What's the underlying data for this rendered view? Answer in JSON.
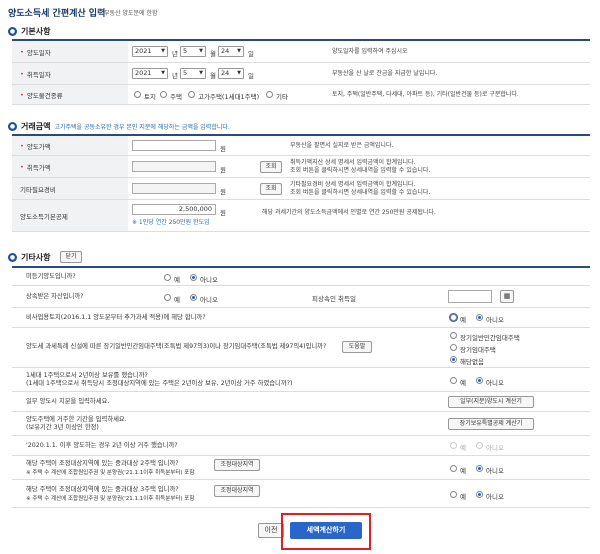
{
  "page": {
    "title": "양도소득세 간편계산 입력",
    "subtitle": "부동산 양도분에 한함"
  },
  "basic": {
    "heading": "기본사항",
    "transfer_date": {
      "label": "양도일자",
      "year": "2021",
      "year_unit": "년",
      "month": "5",
      "month_unit": "월",
      "day": "24",
      "day_unit": "일",
      "desc": "양도일자를 입력하여 주십시오"
    },
    "acquire_date": {
      "label": "취득일자",
      "year": "2021",
      "year_unit": "년",
      "month": "5",
      "month_unit": "월",
      "day": "24",
      "day_unit": "일",
      "desc": "부동산을 산 날로 잔금을 지급한 날입니다."
    },
    "property_type": {
      "label": "양도물건종류",
      "options": [
        "토지",
        "주택",
        "고가주택(1세대1주택)",
        "기타"
      ],
      "desc": "토지, 주택(일반주택, 다세대, 아파트 등), 기타(일반건물 등)로 구분합니다."
    }
  },
  "amount": {
    "heading": "거래금액",
    "note": "고가주택을 공동소유한 경우 본인 지분에 해당하는 금액을 입력합니다.",
    "transfer_price": {
      "label": "양도가액",
      "unit": "원",
      "desc": "부동산을 팔면서 실지로 받은 금액입니다."
    },
    "acquire_price": {
      "label": "취득가액",
      "unit": "원",
      "button": "조회",
      "desc": "취득가액지산 상세 명세서 입력금액이 합계입니다.\n조회 버튼을 클릭하시면 상세내역을 입력할 수 있습니다."
    },
    "other_cost": {
      "label": "기타필요경비",
      "unit": "원",
      "button": "조회",
      "desc": "기타필요경비 상세 명세서 입력금액이 합계입니다.\n조회 버튼을 클릭하시면 상세내역을 입력할 수 있습니다."
    },
    "basic_deduction": {
      "label": "양도소득기본공제",
      "value": "2,500,000",
      "unit": "원",
      "hint": "※ 1인당 연간 250만원 한도임",
      "desc": "해당 과세기간의 양도소득금액에서 인별로 연간 250만원 공제됩니다."
    }
  },
  "etc": {
    "heading": "기타사항",
    "close_button": "닫기",
    "q1": {
      "text": "미등기양도입니까?",
      "yes": "예",
      "no": "아니오"
    },
    "q2": {
      "text": "상속받은 자산입니까?",
      "yes": "예",
      "no": "아니오",
      "sub_label": "피상속인 취득일"
    },
    "q3": {
      "text": "비사업용토지(2016.1.1 양도분부터 추가과세 적용)에 해당 합니까?",
      "yes": "예",
      "no": "아니오"
    },
    "q4": {
      "text": "양도세 과세특례 신설에 따른 장기일반민간임대주택(조특법 제97의3)이나 장기임대주택(조특법 제97의4)입니까?",
      "help": "도움말",
      "options": [
        "장기일반민간임대주택",
        "장기임대주택",
        "해당없음"
      ]
    },
    "q5": {
      "text": "1세대 1주택으로서 2년이상 보유를 했습니까?",
      "text2": "(1세대 1주택으로서 취득당시 조정대상지역에 있는 주택은 2년이상 보유, 2년이상 거주 하였습니까?)",
      "yes": "예",
      "no": "아니오"
    },
    "q6": {
      "text": "일부 양도시 지분을 입력하세요.",
      "button": "일부(지분)양도시 계산기"
    },
    "q7": {
      "text": "양도주택에 거주한 기간을 입력하세요.",
      "text2": "(보유기간 3년 이상인 한정)",
      "button": "장기보유특별공제 계산기"
    },
    "q8": {
      "text": "'2020.1.1. 이후 양도하는 경우 2년 이상 거주 했습니까?",
      "yes": "예",
      "no": "아니오"
    },
    "q9": {
      "text": "해당 주택이 조정대상지역에 있는 중과대상 2주택 입니까?",
      "note": "※ 주택 수 계산에 조합원입주권 및 분양권('21.1.1이후 취득분부터) 포함",
      "button": "조정대상지역",
      "yes": "예",
      "no": "아니오"
    },
    "q10": {
      "text": "해당 주택이 조정대상지역에 있는 중과대상 3주택 입니까?",
      "note": "※ 주택 수 계산에 조합원입주권 및 분양권('21.1.1이후 취득분부터) 포함",
      "button": "조정대상지역",
      "yes": "예",
      "no": "아니오"
    }
  },
  "footer": {
    "prev": "이전",
    "calc": "세액계산하기"
  },
  "colors": {
    "primary": "#1f4f9c",
    "highlight": "#e02020",
    "button_blue": "#2a66c9"
  }
}
